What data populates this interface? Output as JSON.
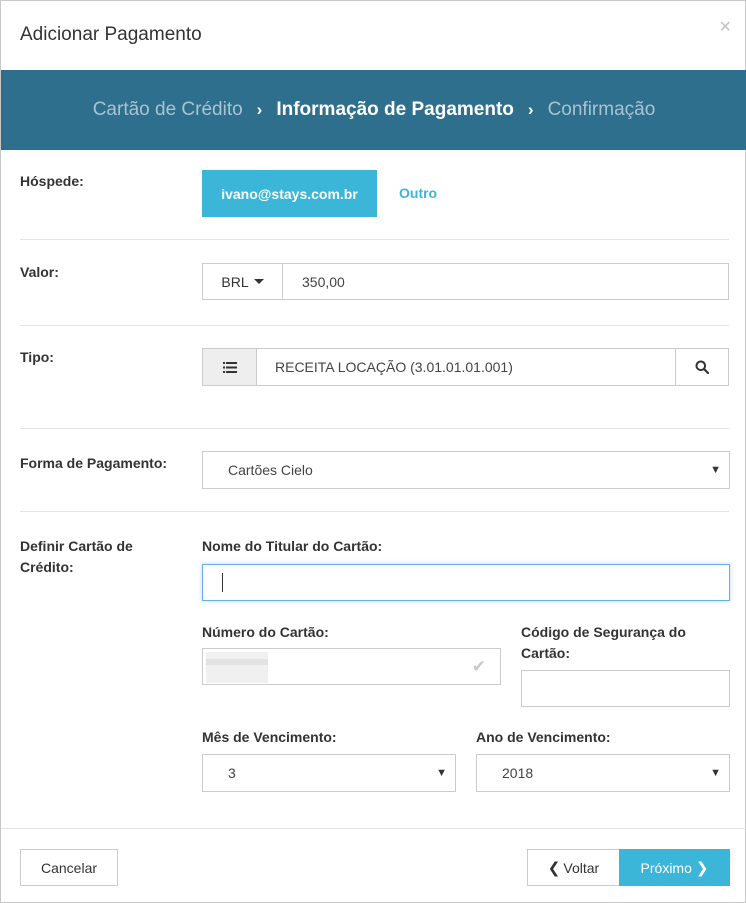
{
  "modal": {
    "title": "Adicionar Pagamento",
    "close_symbol": "×"
  },
  "steps": [
    {
      "label": "Cartão de Crédito",
      "active": false
    },
    {
      "label": "Informação de Pagamento",
      "active": true
    },
    {
      "label": "Confirmação",
      "active": false
    }
  ],
  "step_separator": "›",
  "guest": {
    "label": "Hóspede:",
    "selected_email": "ivano@stays.com.br",
    "other_link": "Outro"
  },
  "amount": {
    "label": "Valor:",
    "currency": "BRL",
    "value": "350,00"
  },
  "type": {
    "label": "Tipo:",
    "value": "RECEITA LOCAÇÃO (3.01.01.01.001)",
    "list_icon": "list-icon",
    "search_icon": "search-icon"
  },
  "payment_method": {
    "label": "Forma de Pagamento:",
    "selected": "Cartões Cielo"
  },
  "credit_card": {
    "section_label": "Definir Cartão de Crédito:",
    "holder_label": "Nome do Titular do Cartão:",
    "holder_value": "",
    "number_label": "Número do Cartão:",
    "security_label": "Código de Segurança do Cartão:",
    "security_value": "",
    "month_label": "Mês de Vencimento:",
    "month_selected": "3",
    "year_label": "Ano de Vencimento:",
    "year_selected": "2018"
  },
  "footer": {
    "cancel_label": "Cancelar",
    "back_label": "Voltar",
    "next_label": "Próximo"
  },
  "colors": {
    "header_bar": "#2f6f8e",
    "accent": "#3bb5d8",
    "focus_border": "#66afe9"
  }
}
